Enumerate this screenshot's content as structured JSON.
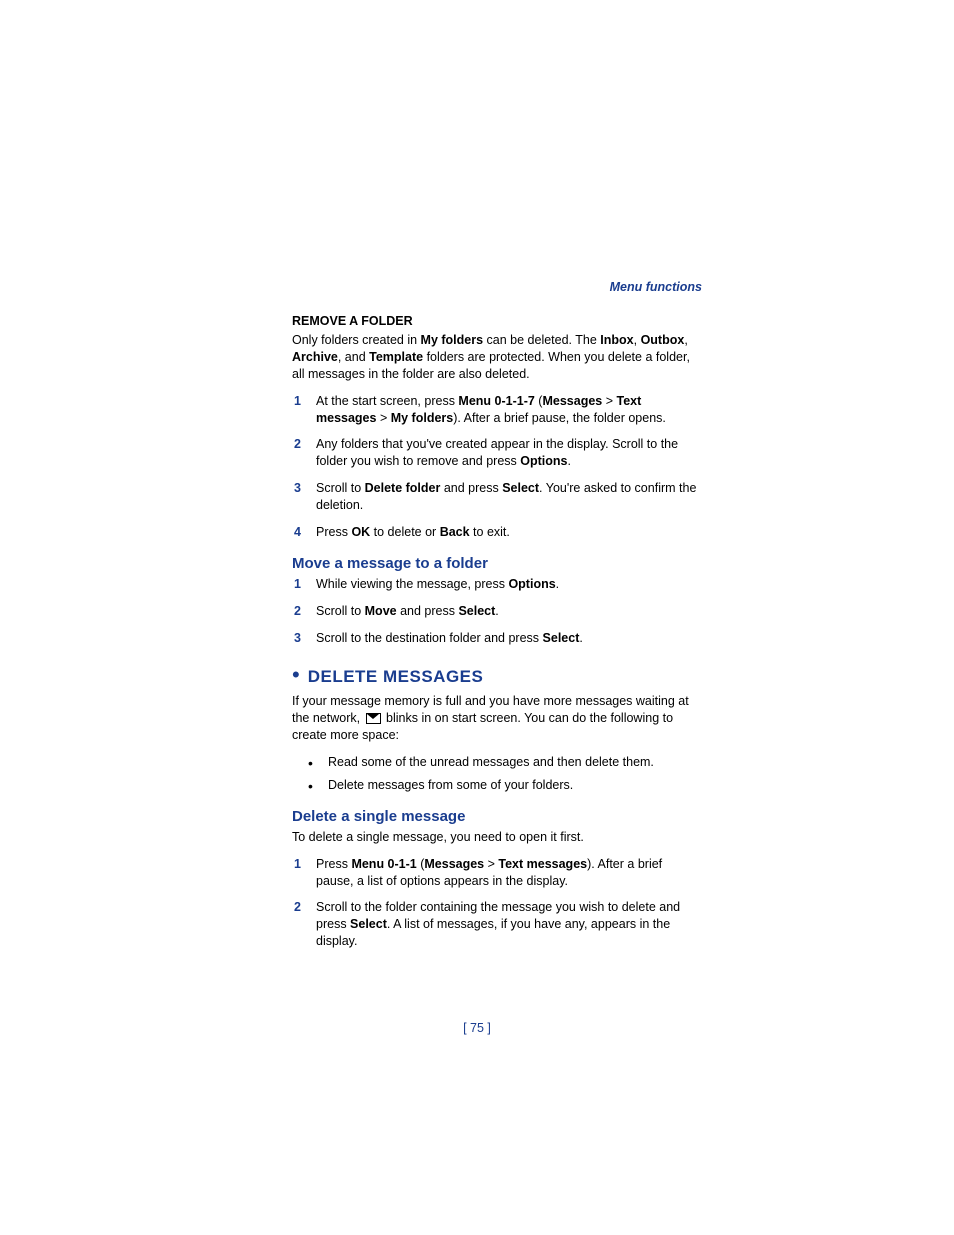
{
  "header": "Menu functions",
  "removeFolder": {
    "title": "REMOVE A FOLDER",
    "intro_parts": [
      "Only folders created in ",
      "My folders",
      " can be deleted. The ",
      "Inbox",
      ", ",
      "Outbox",
      ", ",
      "Archive",
      ", and ",
      "Template",
      " folders are protected. When you delete a folder, all messages in the folder are also deleted."
    ],
    "steps": [
      {
        "n": "1",
        "parts": [
          "At the start screen, press ",
          "Menu 0-1-1-7",
          " (",
          "Messages",
          " > ",
          "Text messages",
          " > ",
          "My folders",
          "). After a brief pause, the folder opens."
        ]
      },
      {
        "n": "2",
        "parts": [
          "Any folders that you've created appear in the display. Scroll to the folder you wish to remove and press ",
          "Options",
          "."
        ]
      },
      {
        "n": "3",
        "parts": [
          "Scroll to ",
          "Delete folder",
          " and press ",
          "Select",
          ". You're asked to confirm the deletion."
        ]
      },
      {
        "n": "4",
        "parts": [
          "Press ",
          "OK",
          " to delete or ",
          "Back",
          " to exit."
        ]
      }
    ]
  },
  "moveMessage": {
    "title": "Move a message to a folder",
    "steps": [
      {
        "n": "1",
        "parts": [
          "While viewing the message, press ",
          "Options",
          "."
        ]
      },
      {
        "n": "2",
        "parts": [
          "Scroll to ",
          "Move",
          " and press ",
          "Select",
          "."
        ]
      },
      {
        "n": "3",
        "parts": [
          "Scroll to the destination folder and press ",
          "Select",
          "."
        ]
      }
    ]
  },
  "deleteMessages": {
    "title": "DELETE MESSAGES",
    "intro_before": "If your message memory is full and you have more messages waiting at the network, ",
    "intro_after": " blinks in on start screen. You can do the following to create more space:",
    "bullets": [
      "Read some of the unread messages and then delete them.",
      "Delete messages from some of your folders."
    ]
  },
  "deleteSingle": {
    "title": "Delete a single message",
    "intro": "To delete a single message, you need to open it first.",
    "steps": [
      {
        "n": "1",
        "parts": [
          "Press ",
          "Menu 0-1-1",
          " (",
          "Messages",
          " > ",
          "Text messages",
          "). After a brief pause, a list of options appears in the display."
        ]
      },
      {
        "n": "2",
        "parts": [
          "Scroll to the folder containing the message you wish to delete and press ",
          "Select",
          ". A list of messages, if you have any, appears in the display."
        ]
      }
    ]
  },
  "pageNumber": "[ 75 ]"
}
